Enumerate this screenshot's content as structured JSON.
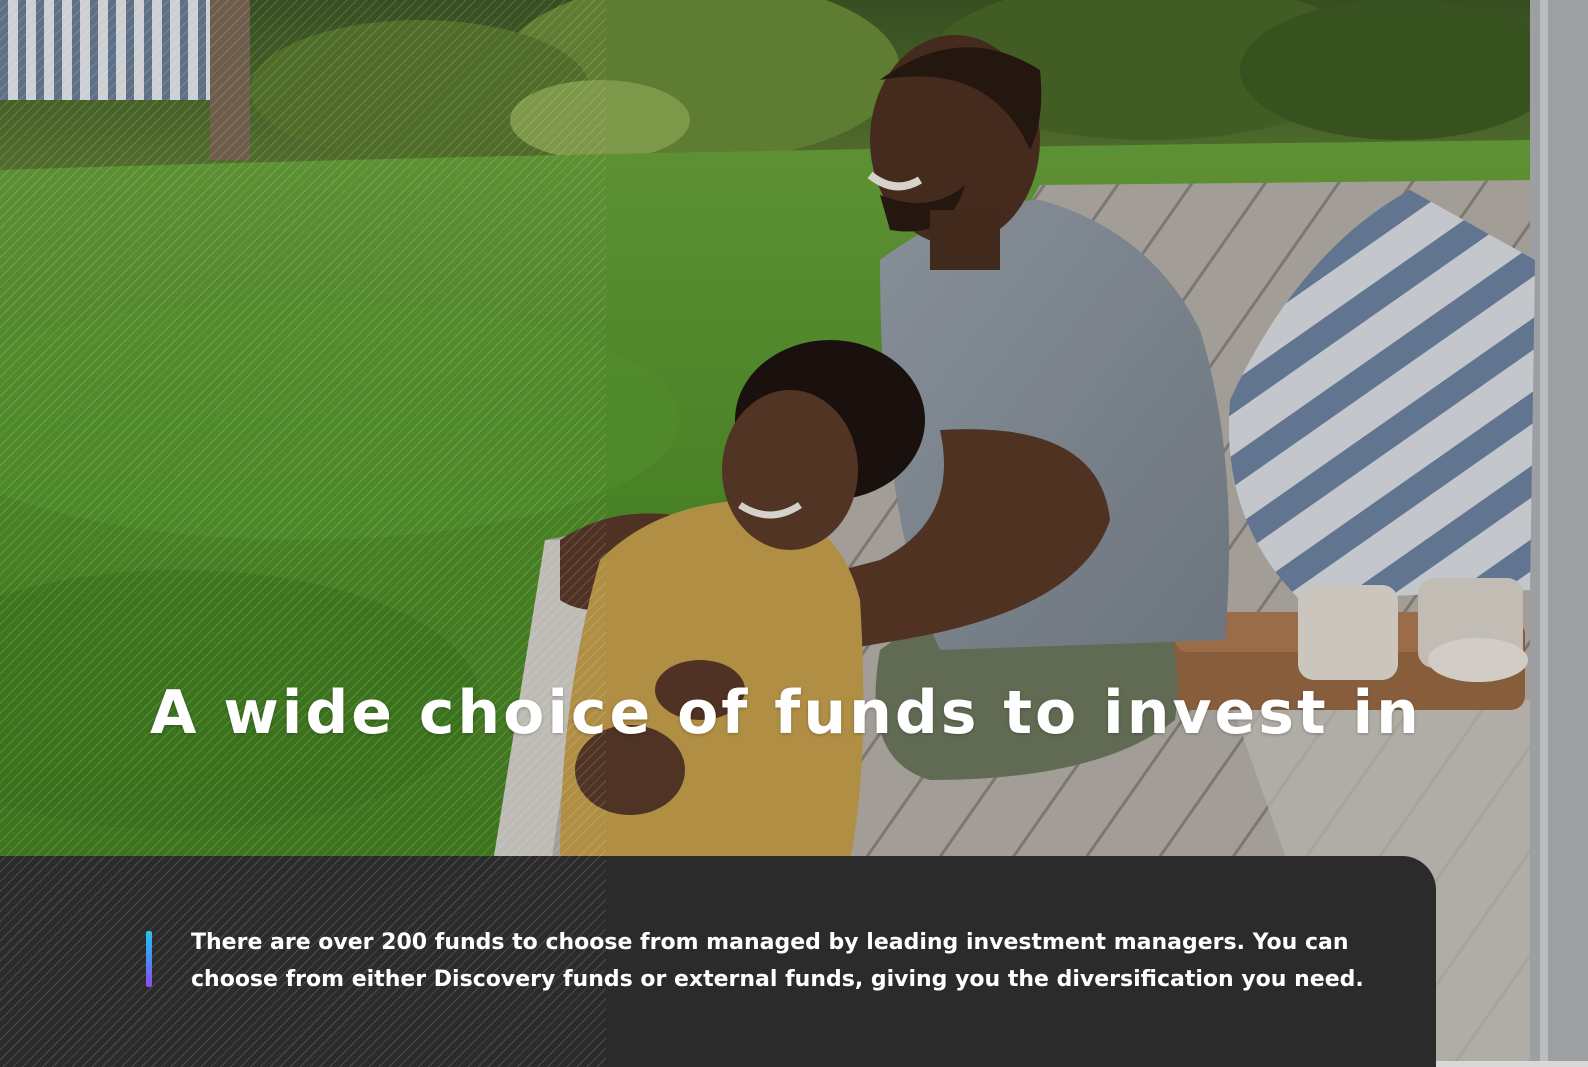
{
  "hero": {
    "image_icon": "couple-sitting-on-deck-photo",
    "headline": "A wide choice of funds to invest in"
  },
  "info": {
    "description": "There are over 200 funds to choose from managed by leading investment managers. You can choose from either Discovery funds or external funds, giving you the diversification you need."
  },
  "colors": {
    "panel_background": "#2b2b2b",
    "text": "#ffffff",
    "accent_gradient_start": "#28c3f0",
    "accent_gradient_end": "#8a4cf0"
  }
}
